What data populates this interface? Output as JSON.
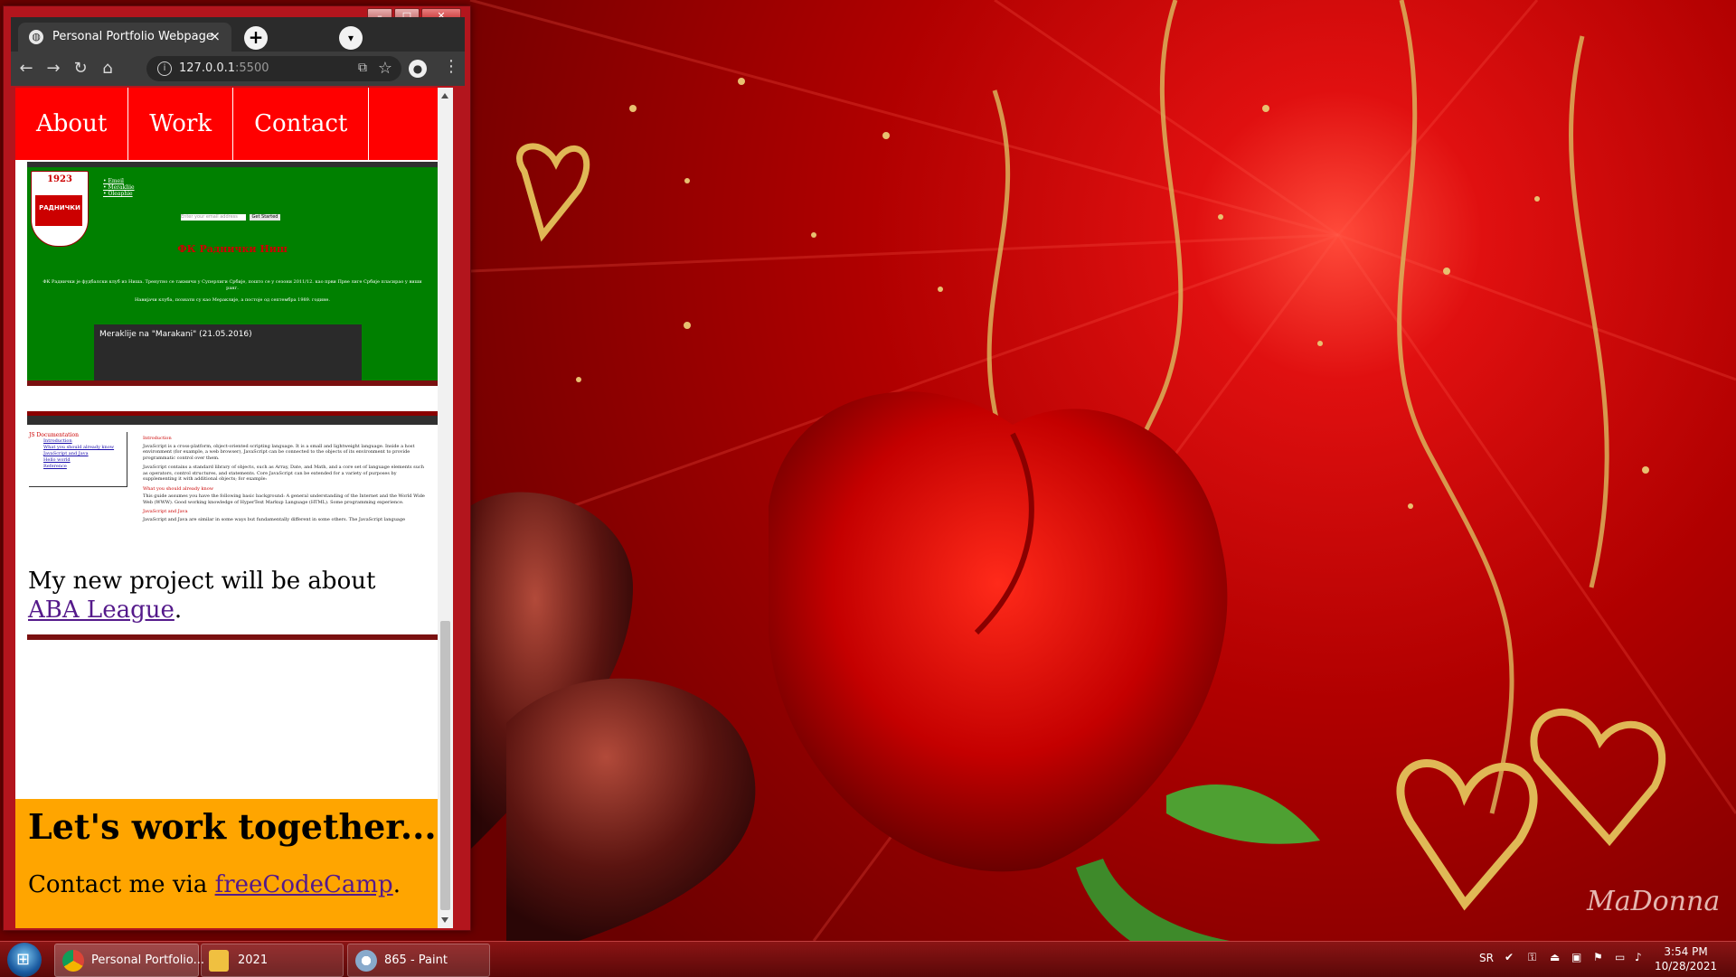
{
  "browser": {
    "tab_title": "Personal Portfolio Webpage",
    "tab_close": "×",
    "new_tab": "+",
    "url_host": "127.0.0.1",
    "url_port": ":5500",
    "window_controls": {
      "minimize": "–",
      "maximize": "□",
      "close": "✕"
    },
    "icons": {
      "back": "arrow-left",
      "forward": "arrow-right",
      "reload": "refresh",
      "home": "home",
      "info": "info",
      "translate": "translate",
      "star": "star",
      "profile": "person",
      "menu": "kebab"
    }
  },
  "page": {
    "nav": [
      "About",
      "Work",
      "Contact"
    ],
    "project1": {
      "year": "1923",
      "crest_word": "РАДНИЧКИ",
      "links": [
        "Emeil",
        "Merakliie",
        "Oleaphie"
      ],
      "input_placeholder": "Enter your email address",
      "button": "Get Started",
      "club_title": "ФК Раднички Ниш",
      "text1": "ФК Раднички је фудбалски клуб из Ниша. Тренутно се такмичи у Суперлиги Србије, пошто се у сезони 2011/12. као први Прве лиге Србије пласирао у виши ранг.",
      "text2": "Навијачи клуба, познати су као Мераклије, а постоје од септембра 1989. године.",
      "video_title": "Meraklije na \"Marakani\" (21.05.2016)"
    },
    "project2": {
      "side_title": "JS Documentation",
      "side_links": [
        "Introduction",
        "What you should already know",
        "JavaScript and Java",
        "Hello world",
        "Reference"
      ],
      "sections": [
        {
          "title": "Introduction",
          "text": "JavaScript is a cross-platform, object-oriented scripting language. It is a small and lightweight language. Inside a host environment (for example, a web browser), JavaScript can be connected to the objects of its environment to provide programmatic control over them."
        },
        {
          "title": "",
          "text": "JavaScript contains a standard library of objects, such as Array, Date, and Math, and a core set of language elements such as operators, control structures, and statements. Core JavaScript can be extended for a variety of purposes by supplementing it with additional objects; for example:"
        },
        {
          "title": "What you should already know",
          "text": "This guide assumes you have the following basic background: A general understanding of the Internet and the World Wide Web (WWW). Good working knowledge of HyperText Markup Language (HTML). Some programming experience."
        },
        {
          "title": "JavaScript and Java",
          "text": "JavaScript and Java are similar in some ways but fundamentally different in some others. The JavaScript language"
        }
      ]
    },
    "new_project_prefix": "My new project will be about ",
    "new_project_link": "ABA League",
    "new_project_suffix": ".",
    "contact_heading": "Let's work together...",
    "contact_prefix": "Contact me via ",
    "contact_link": "freeCodeCamp",
    "contact_suffix": "."
  },
  "desktop": {
    "signature": "MaDonna"
  },
  "taskbar": {
    "items": [
      {
        "label": "Personal Portfolio...",
        "icon": "chrome-icon"
      },
      {
        "label": "2021",
        "icon": "folder-icon"
      },
      {
        "label": "865 - Paint",
        "icon": "paint-icon"
      }
    ],
    "language": "SR",
    "time": "3:54 PM",
    "date": "10/28/2021"
  },
  "colors": {
    "nav_bg": "#ff0000",
    "contact_bg": "#ffa500",
    "project1_bg": "#008000",
    "link": "#551a8b"
  }
}
